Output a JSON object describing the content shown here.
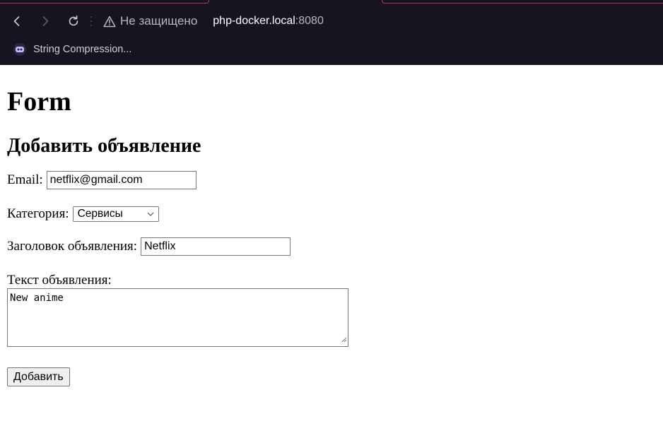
{
  "browser": {
    "security_label": "Не защищено",
    "url_host": "php-docker.local",
    "url_port": ":8080",
    "bookmarks": [
      {
        "label": "String Compression..."
      }
    ]
  },
  "page": {
    "title": "Form",
    "subtitle": "Добавить объявление",
    "form": {
      "email_label": "Email:",
      "email_value": "netflix@gmail.com",
      "category_label": "Категория:",
      "category_selected": "Сервисы",
      "title_label": "Заголовок объявления:",
      "title_value": "Netflix",
      "text_label": "Текст объявления:",
      "text_value": "New anime",
      "submit_label": "Добавить"
    }
  }
}
